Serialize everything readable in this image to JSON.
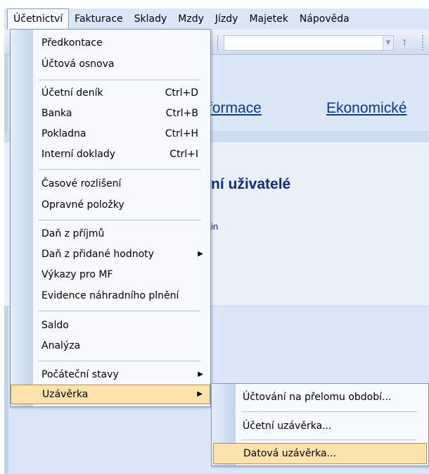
{
  "menubar": {
    "items": [
      {
        "label": "Účetnictví",
        "active": true
      },
      {
        "label": "Fakturace"
      },
      {
        "label": "Sklady"
      },
      {
        "label": "Mzdy"
      },
      {
        "label": "Jízdy"
      },
      {
        "label": "Majetek"
      },
      {
        "label": "Nápověda"
      }
    ]
  },
  "toolbar": {
    "combo_icon": "dropdown-arrow",
    "filter_icon": "filter-icon"
  },
  "content": {
    "link_informace": "formace",
    "link_ekonomicke": "Ekonomické",
    "heading_uzivatele": "ní uživatelé",
    "small_text": "in"
  },
  "menu": {
    "items": [
      {
        "label": "Předkontace",
        "shortcut": ""
      },
      {
        "label": "Účtová osnova",
        "shortcut": ""
      },
      {
        "label": "Účetní deník",
        "shortcut": "Ctrl+D"
      },
      {
        "label": "Banka",
        "shortcut": "Ctrl+B"
      },
      {
        "label": "Pokladna",
        "shortcut": "Ctrl+H"
      },
      {
        "label": "Interní doklady",
        "shortcut": "Ctrl+I"
      },
      {
        "label": "Časové rozlišení",
        "shortcut": ""
      },
      {
        "label": "Opravné položky",
        "shortcut": ""
      },
      {
        "label": "Daň z příjmů",
        "shortcut": ""
      },
      {
        "label": "Daň z přidané hodnoty",
        "shortcut": "",
        "submenu": true
      },
      {
        "label": "Výkazy pro MF",
        "shortcut": ""
      },
      {
        "label": "Evidence náhradního plnění",
        "shortcut": ""
      },
      {
        "label": "Saldo",
        "shortcut": ""
      },
      {
        "label": "Analýza",
        "shortcut": ""
      },
      {
        "label": "Počáteční stavy",
        "shortcut": "",
        "submenu": true
      },
      {
        "label": "Uzávěrka",
        "shortcut": "",
        "submenu": true,
        "highlighted": true
      }
    ]
  },
  "submenu": {
    "items": [
      {
        "label": "Účtování na přelomu období..."
      },
      {
        "label": "Účetní uzávěrka..."
      },
      {
        "label": "Datová uzávěrka...",
        "highlighted": true
      }
    ]
  },
  "colors": {
    "menu_highlight": "#fbe3ab",
    "link_blue": "#0d3a8c",
    "background": "#dbe7f7"
  }
}
